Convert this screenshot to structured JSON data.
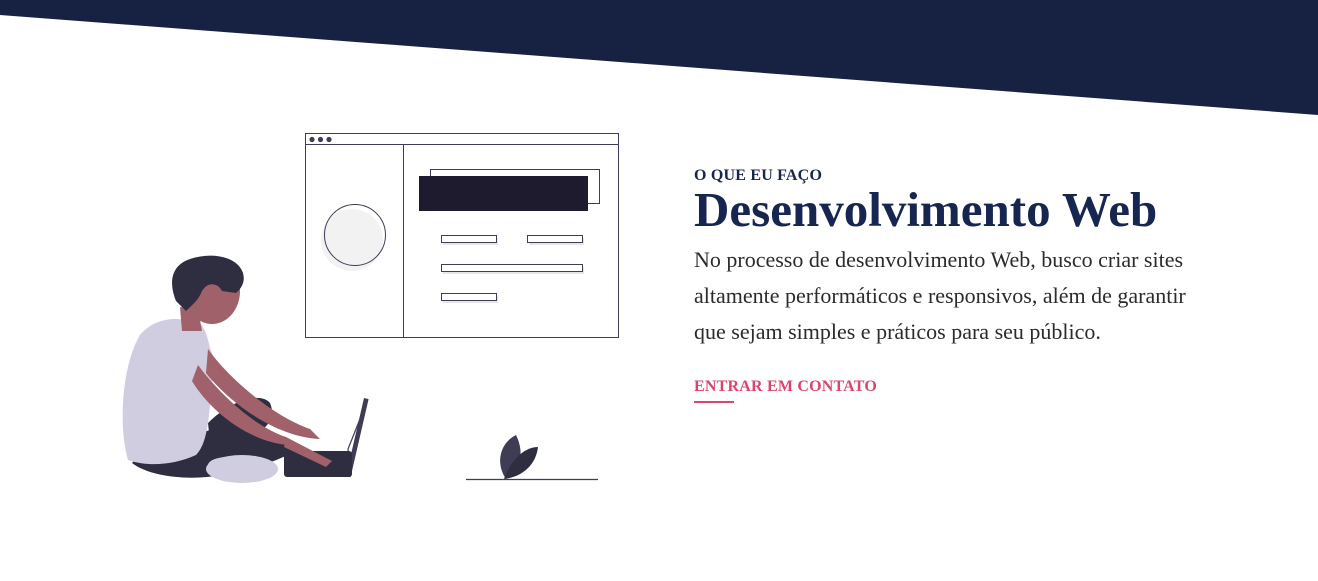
{
  "section": {
    "eyebrow": "O QUE EU FAÇO",
    "title": "Desenvolvimento Web",
    "description": "No processo de desenvolvimento Web, busco criar sites altamente performáticos e responsivos, além de garantir que sejam simples e práticos para seu público.",
    "cta_label": "ENTRAR EM CONTATO"
  },
  "colors": {
    "band": "#172242",
    "heading": "#162650",
    "body_text": "#2b2b2b",
    "accent": "#d9456d",
    "illustration_dark": "#2f2e41",
    "illustration_skin": "#a0616a",
    "illustration_shirt": "#d0cde1"
  },
  "illustration": {
    "icons": [
      "browser-window-icon",
      "person-with-laptop-icon",
      "plant-icon"
    ]
  }
}
